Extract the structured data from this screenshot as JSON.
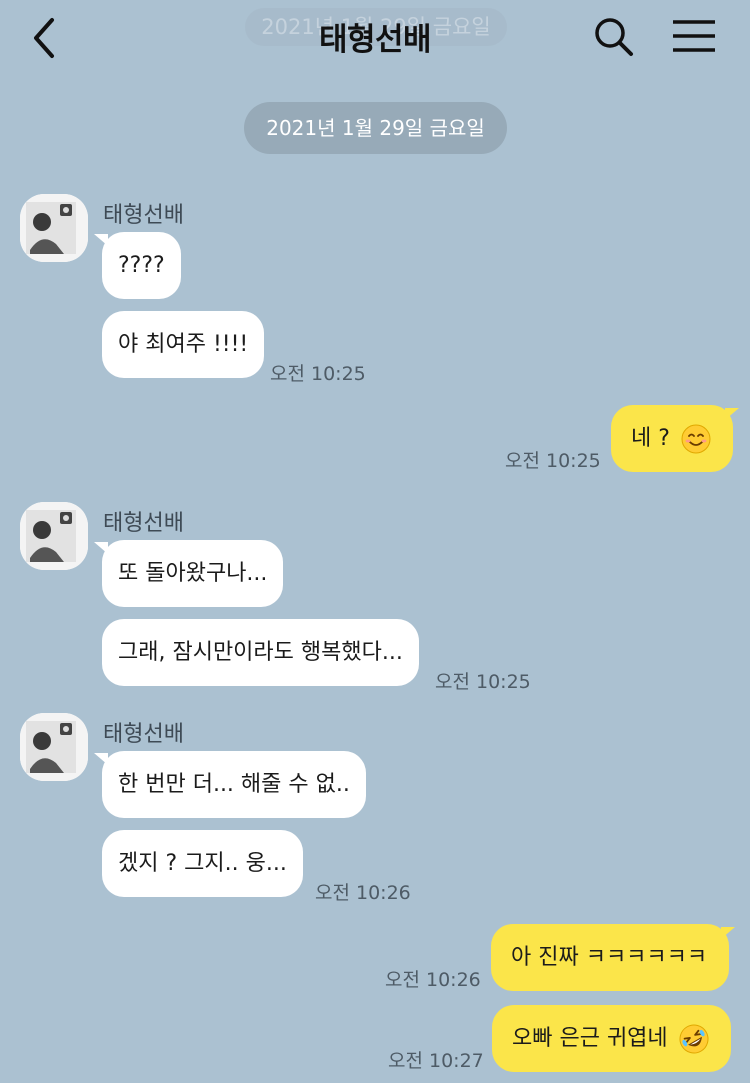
{
  "header": {
    "title": "태형선배",
    "ghost_date": "2021년 1월 29일 금요일"
  },
  "date_divider": "2021년 1월 29일 금요일",
  "messages": {
    "g1": {
      "sender": "태형선배",
      "m1": "????",
      "m2": "야 최여주 !!!!",
      "time": "오전 10:25"
    },
    "o1": {
      "text": "네 ?",
      "emoji": "smiling-face-emoji",
      "time": "오전 10:25"
    },
    "g2": {
      "sender": "태형선배",
      "m1": "또 돌아왔구나...",
      "m2": "그래, 잠시만이라도 행복했다...",
      "time": "오전 10:25"
    },
    "g3": {
      "sender": "태형선배",
      "m1": "한 번만 더... 해줄 수 없..",
      "m2": "겠지 ? 그지.. 웅...",
      "time": "오전 10:26"
    },
    "o2": {
      "text": "아 진짜 ㅋㅋㅋㅋㅋㅋ",
      "time": "오전 10:26"
    },
    "o3": {
      "text": "오빠 은근 귀엽네",
      "emoji": "rolling-laughing-emoji",
      "time": "오전 10:27"
    }
  },
  "colors": {
    "background": "#abc1d1",
    "my_bubble": "#fbe54a",
    "their_bubble": "#ffffff",
    "date_pill": "#97aab8"
  },
  "icons": [
    "back-arrow-icon",
    "search-icon",
    "menu-icon"
  ]
}
